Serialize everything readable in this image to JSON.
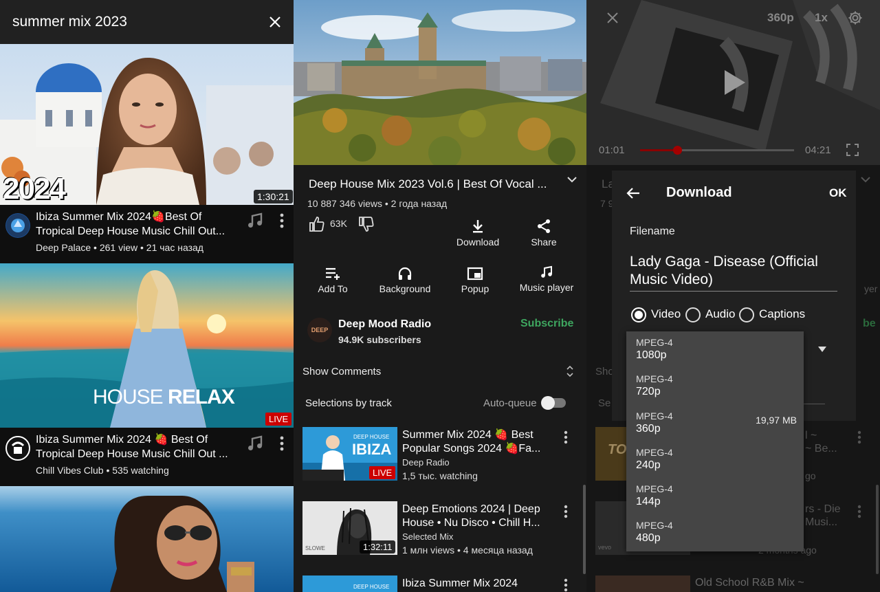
{
  "search": {
    "query": "summer mix 2023"
  },
  "results": [
    {
      "title": "Ibiza Summer Mix 2024🍓Best Of Tropical Deep House Music Chill Out...",
      "meta": "Deep Palace • 261 view • 21 час назад",
      "badge": "1:30:21",
      "overlay": "2024"
    },
    {
      "title": "Ibiza Summer Mix 2024 🍓 Best Of Tropical Deep House Music Chill Out ...",
      "meta": "Chill Vibes Club • 535 watching",
      "badge": "LIVE",
      "overlay_a": "HOUSE ",
      "overlay_b": "RELAX"
    }
  ],
  "video": {
    "title": "Deep House Mix 2023 Vol.6 | Best Of Vocal ...",
    "meta": "10 887 346 views • 2 года назад",
    "likes": "63K",
    "actions": {
      "download": "Download",
      "share": "Share",
      "add_to": "Add To",
      "background": "Background",
      "popup": "Popup",
      "music_player": "Music player"
    },
    "channel": {
      "name": "Deep Mood Radio",
      "subscribers": "94.9K subscribers",
      "subscribe": "Subscribe",
      "avatar_text": "DEEP"
    },
    "comments": "Show Comments",
    "selections": "Selections by track",
    "autoqueue": "Auto-queue"
  },
  "recommendations": [
    {
      "title": "Summer Mix 2024 🍓 Best Popular Songs 2024 🍓Fa...",
      "channel": "Deep Radio",
      "meta": "1,5 тыс. watching",
      "badge": "LIVE",
      "thumb_a": "DEEP HOUSE",
      "thumb_b": "IBIZA"
    },
    {
      "title": "Deep Emotions 2024 | Deep House • Nu Disco • Chill H...",
      "channel": "Selected Mix",
      "meta": "1 млн views • 4 месяца назад",
      "badge": "1:32:11",
      "thumb_a": "SLOWE"
    },
    {
      "title": "Ibiza Summer Mix 2024",
      "thumb_a": "DEEP HOUSE"
    }
  ],
  "player": {
    "quality": "360p",
    "speed": "1x",
    "time_current": "01:01",
    "time_total": "04:21",
    "progress": 0.24
  },
  "dialog": {
    "title": "Download",
    "ok": "OK",
    "filename_label": "Filename",
    "filename_value": "Lady Gaga - Disease (Official Music Video)",
    "types": [
      "Video",
      "Audio",
      "Captions"
    ],
    "selected_type": "Video",
    "formats": [
      {
        "fmt": "MPEG-4",
        "res": "1080p",
        "size": ""
      },
      {
        "fmt": "MPEG-4",
        "res": "720p",
        "size": ""
      },
      {
        "fmt": "MPEG-4",
        "res": "360p",
        "size": "19,97 MB"
      },
      {
        "fmt": "MPEG-4",
        "res": "240p",
        "size": ""
      },
      {
        "fmt": "MPEG-4",
        "res": "144p",
        "size": ""
      },
      {
        "fmt": "MPEG-4",
        "res": "480p",
        "size": ""
      }
    ]
  },
  "background_fragments": {
    "t1": "La",
    "t2": "7 9",
    "t3": "yer",
    "t4": "be",
    "t5": "Sho",
    "t6": "Se",
    "r1a": "l ~",
    "r1b": "~ Be...",
    "r1c": "go",
    "r1thumb": "TOP",
    "r2a": "rs - Die",
    "r2b": "Musi...",
    "r2c": "vevo",
    "r2d": "2 months ago",
    "r3": "Old School R&B Mix ~"
  },
  "colors": {
    "accent": "#ff0000",
    "subscribe": "#3ea65f",
    "menu_bg": "#454545",
    "dialog_bg": "#212121"
  }
}
